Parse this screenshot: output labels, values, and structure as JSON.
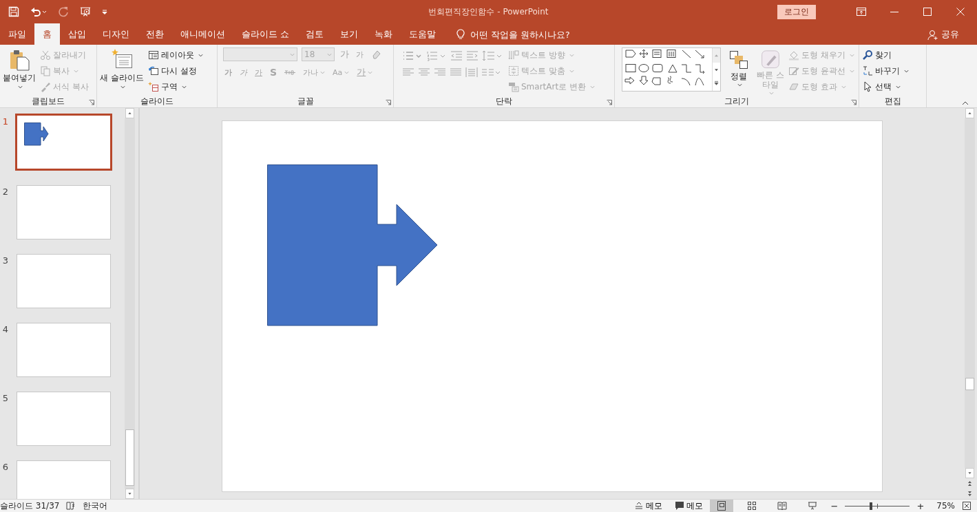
{
  "quick_access": [
    {
      "kind": "save",
      "disabled": false
    },
    {
      "kind": "undo",
      "disabled": false
    },
    {
      "kind": "redo",
      "disabled": true
    },
    {
      "kind": "present",
      "disabled": false
    },
    {
      "kind": "customize",
      "disabled": false
    }
  ],
  "window": {
    "title": "번회편직장인함수  -  PowerPoint",
    "login": "로그인"
  },
  "tabs": [
    {
      "label": "파일",
      "selected": false
    },
    {
      "label": "홈",
      "selected": true
    },
    {
      "label": "삽입",
      "selected": false
    },
    {
      "label": "디자인",
      "selected": false
    },
    {
      "label": "전환",
      "selected": false
    },
    {
      "label": "애니메이션",
      "selected": false
    },
    {
      "label": "슬라이드 쇼",
      "selected": false
    },
    {
      "label": "검토",
      "selected": false
    },
    {
      "label": "보기",
      "selected": false
    },
    {
      "label": "녹화",
      "selected": false
    },
    {
      "label": "도움말",
      "selected": false
    }
  ],
  "tell_me": "어떤 작업을 원하시나요?",
  "share": "공유",
  "ribbon": {
    "groups": [
      {
        "kind": "clipboard",
        "label": "클립보드",
        "launcher": true,
        "large": [
          {
            "label": "붙여넣기",
            "disabled": false,
            "dropdown": true
          }
        ],
        "items": [
          {
            "label": "잘라내기",
            "disabled": true,
            "dropdown": false
          },
          {
            "label": "복사",
            "disabled": true,
            "dropdown": true
          },
          {
            "label": "서식 복사",
            "disabled": true,
            "dropdown": false
          }
        ]
      },
      {
        "kind": "slides",
        "label": "슬라이드",
        "launcher": false,
        "large": [
          {
            "label": "새 슬라이드",
            "disabled": false,
            "dropdown": true
          }
        ],
        "items": [
          {
            "label": "레이아웃",
            "disabled": false,
            "dropdown": true
          },
          {
            "label": "다시 설정",
            "disabled": false,
            "dropdown": false
          },
          {
            "label": "구역",
            "disabled": false,
            "dropdown": true
          }
        ]
      },
      {
        "kind": "font",
        "label": "글꼴",
        "launcher": true,
        "disabled": true,
        "font_size": "18",
        "row1": [
          {
            "kind": "grow",
            "label": "가"
          },
          {
            "kind": "shrink",
            "label": "가"
          },
          {
            "kind": "clear"
          }
        ],
        "row2": [
          {
            "kind": "bold",
            "label": "가"
          },
          {
            "kind": "italic",
            "label": "가"
          },
          {
            "kind": "underline",
            "label": "가"
          },
          {
            "kind": "shadow",
            "label": "S"
          },
          {
            "kind": "strike"
          },
          {
            "kind": "spacing",
            "label": "가나"
          },
          {
            "kind": "case",
            "label": "Aa"
          },
          {
            "kind": "color",
            "label": "가"
          }
        ]
      },
      {
        "kind": "paragraph",
        "label": "단락",
        "launcher": true,
        "disabled": true,
        "items": [
          {
            "label": "텍스트 방향",
            "disabled": true,
            "dropdown": true
          },
          {
            "label": "텍스트 맞춤",
            "disabled": true,
            "dropdown": true
          },
          {
            "label": "SmartArt로 변환",
            "disabled": true,
            "dropdown": true
          }
        ]
      },
      {
        "kind": "drawing",
        "label": "그리기",
        "launcher": true,
        "large": [
          {
            "label": "정렬",
            "disabled": false,
            "dropdown": true
          },
          {
            "label": "빠른 스타일",
            "disabled": true,
            "dropdown": true
          }
        ],
        "items": [
          {
            "label": "도형 채우기",
            "disabled": true,
            "dropdown": true
          },
          {
            "label": "도형 윤곽선",
            "disabled": true,
            "dropdown": true
          },
          {
            "label": "도형 효과",
            "disabled": true,
            "dropdown": true
          }
        ]
      },
      {
        "kind": "editing",
        "label": "편집",
        "launcher": false,
        "items": [
          {
            "label": "찾기",
            "disabled": false,
            "dropdown": false
          },
          {
            "label": "바꾸기",
            "disabled": false,
            "dropdown": true
          },
          {
            "label": "선택",
            "disabled": false,
            "dropdown": true
          }
        ]
      }
    ]
  },
  "slides": [
    {
      "number": "1",
      "selected": true,
      "kind": "shape"
    },
    {
      "number": "2",
      "selected": false,
      "kind": "blank"
    },
    {
      "number": "3",
      "selected": false,
      "kind": "blank"
    },
    {
      "number": "4",
      "selected": false,
      "kind": "blank"
    },
    {
      "number": "5",
      "selected": false,
      "kind": "blank"
    },
    {
      "number": "6",
      "selected": false,
      "kind": "blank"
    }
  ],
  "status_bar": {
    "slide": "슬라이드 31/37",
    "language": "한국어",
    "notes": "메모",
    "comments": "메모",
    "views": [
      {
        "kind": "normal",
        "selected": true
      },
      {
        "kind": "sorter",
        "selected": false
      },
      {
        "kind": "reading",
        "selected": false
      },
      {
        "kind": "show",
        "selected": false
      }
    ],
    "zoom": {
      "minus": "−",
      "plus": "+",
      "level": 0.4,
      "value": "75%"
    }
  }
}
